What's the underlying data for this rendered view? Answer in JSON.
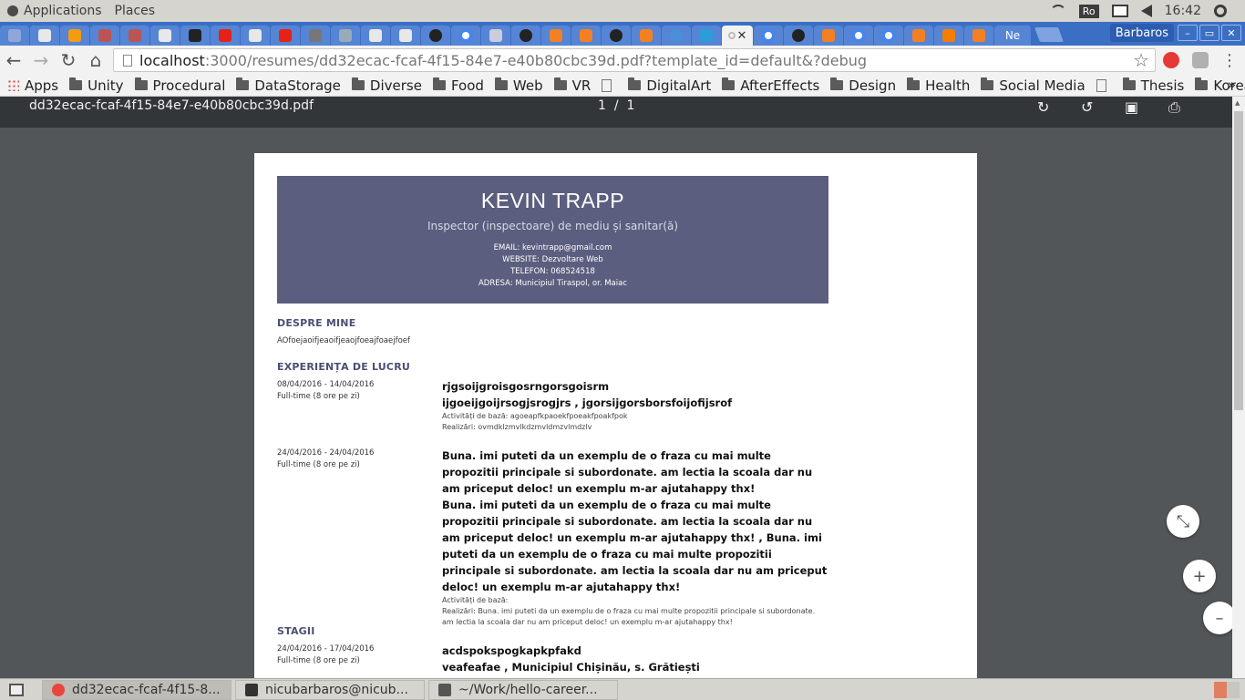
{
  "top_panel": {
    "menus": [
      "Applications",
      "Places"
    ],
    "keyboard": "Ro",
    "clock": "16:42"
  },
  "tabstrip": {
    "last_tab_label": "Ne",
    "user": "Barbaros",
    "window_buttons": [
      "–",
      "▭",
      "✕"
    ]
  },
  "toolbar": {
    "url_host": "localhost",
    "url_path": ":3000/resumes/dd32ecac-fcaf-4f15-84e7-e40b80cbc39d.pdf?template_id=default&?debug"
  },
  "bookmarks": [
    "Apps",
    "Unity",
    "Procedural",
    "DataStorage",
    "Diverse",
    "Food",
    "Web",
    "VR",
    "DigitalArt",
    "AfterEffects",
    "Design",
    "Health",
    "Social Media",
    "Thesis",
    "Korea"
  ],
  "pdf": {
    "filename": "dd32ecac-fcaf-4f15-84e7-e40b80cbc39d.pdf",
    "page_current": "1",
    "page_sep": "/",
    "page_total": "1"
  },
  "cv": {
    "name": "KEVIN TRAPP",
    "role": "Inspector (inspectoare) de mediu și sanitar(ă)",
    "contact": [
      "EMAIL: kevintrapp@gmail.com",
      "WEBSITE: Dezvoltare Web",
      "TELEFON: 068524518",
      "ADRESA: Municipiul Tiraspol, or. Maiac"
    ],
    "about_title": "DESPRE MINE",
    "about_text": "AOfoejaoifjeaoifjeaojfoeajfoaejfoef",
    "experience_title": "EXPERIENȚA DE LUCRU",
    "experience": [
      {
        "date": "08/04/2016 - 14/04/2016",
        "type": "Full-time (8 ore pe zi)",
        "title1": "rjgsoijgroisgosrngorsgoisrm",
        "title2": "ijgoeijgoijrsogjsrogjrs , jgorsijgorsborsfoijofijsrof",
        "activities": "Activități de bază: agoeapfkpaoekfpoeakfpoakfpok",
        "achievements": "Realizări: ovmdklzmvlkdzmvldmzvlmdzlv"
      },
      {
        "date": "24/04/2016 - 24/04/2016",
        "type": "Full-time (8 ore pe zi)",
        "title1": "Buna. imi puteti da un exemplu de o fraza cu mai multe propozitii principale si subordonate. am lectia la scoala dar nu am priceput deloc! un exemplu m-ar ajutahappy thx!",
        "title2": "Buna. imi puteti da un exemplu de o fraza cu mai multe propozitii principale si subordonate. am lectia la scoala dar nu am priceput deloc! un exemplu m-ar ajutahappy thx! , Buna. imi puteti da un exemplu de o fraza cu mai multe propozitii principale si subordonate. am lectia la scoala dar nu am priceput deloc! un exemplu m-ar ajutahappy thx!",
        "activities": "Activități de bază:",
        "achievements": "Realizări: Buna. imi puteti da un exemplu de o fraza cu mai multe propozitii principale si subordonate. am lectia la scoala dar nu am priceput deloc! un exemplu m-ar ajutahappy thx!"
      }
    ],
    "internships_title": "STAGII",
    "internship": {
      "date": "24/04/2016 - 17/04/2016",
      "type": "Full-time (8 ore pe zi)",
      "title1": "acdspokspogkapkpfakd",
      "title2": "veafeafae , Municipiul Chișinău, s. Grătiești"
    }
  },
  "fabs": {
    "fit": "⤡",
    "zoom_in": "+",
    "zoom_out": "–"
  },
  "taskbar": [
    "dd32ecac-fcaf-4f15-8...",
    "nicubarbaros@nicub...",
    "~/Work/hello-career..."
  ],
  "colors": {
    "header_bg": "#5b5e7e",
    "section_title": "#4a4f74",
    "tabstrip": "#3b6fc4"
  }
}
